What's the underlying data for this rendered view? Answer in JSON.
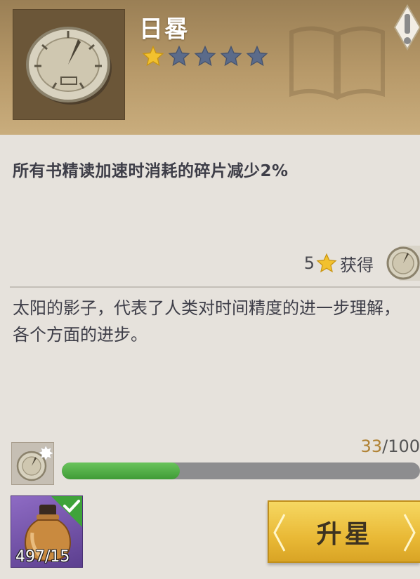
{
  "item": {
    "name": "日晷",
    "rating": 1,
    "max_rating": 5,
    "icon": "sundial-icon"
  },
  "effect": "所有书精读加速时消耗的碎片减少2%",
  "obtain": {
    "stars": "5",
    "label": "获得"
  },
  "description": "太阳的影子，代表了人类对时间精度的进一步理解，各个方面的进步。",
  "progress": {
    "current": "33",
    "separator": "/",
    "max": "100",
    "value": 33,
    "max_value": 100
  },
  "material": {
    "icon": "potion-bottle-icon",
    "count": "497/15",
    "satisfied": true
  },
  "upgrade_button": {
    "label": "升星"
  },
  "colors": {
    "header": "#b89a6a",
    "star_filled": "#f2c12e",
    "star_empty": "#5b6b8a",
    "progress_fill": "#4caf45",
    "button": "#efc445"
  }
}
